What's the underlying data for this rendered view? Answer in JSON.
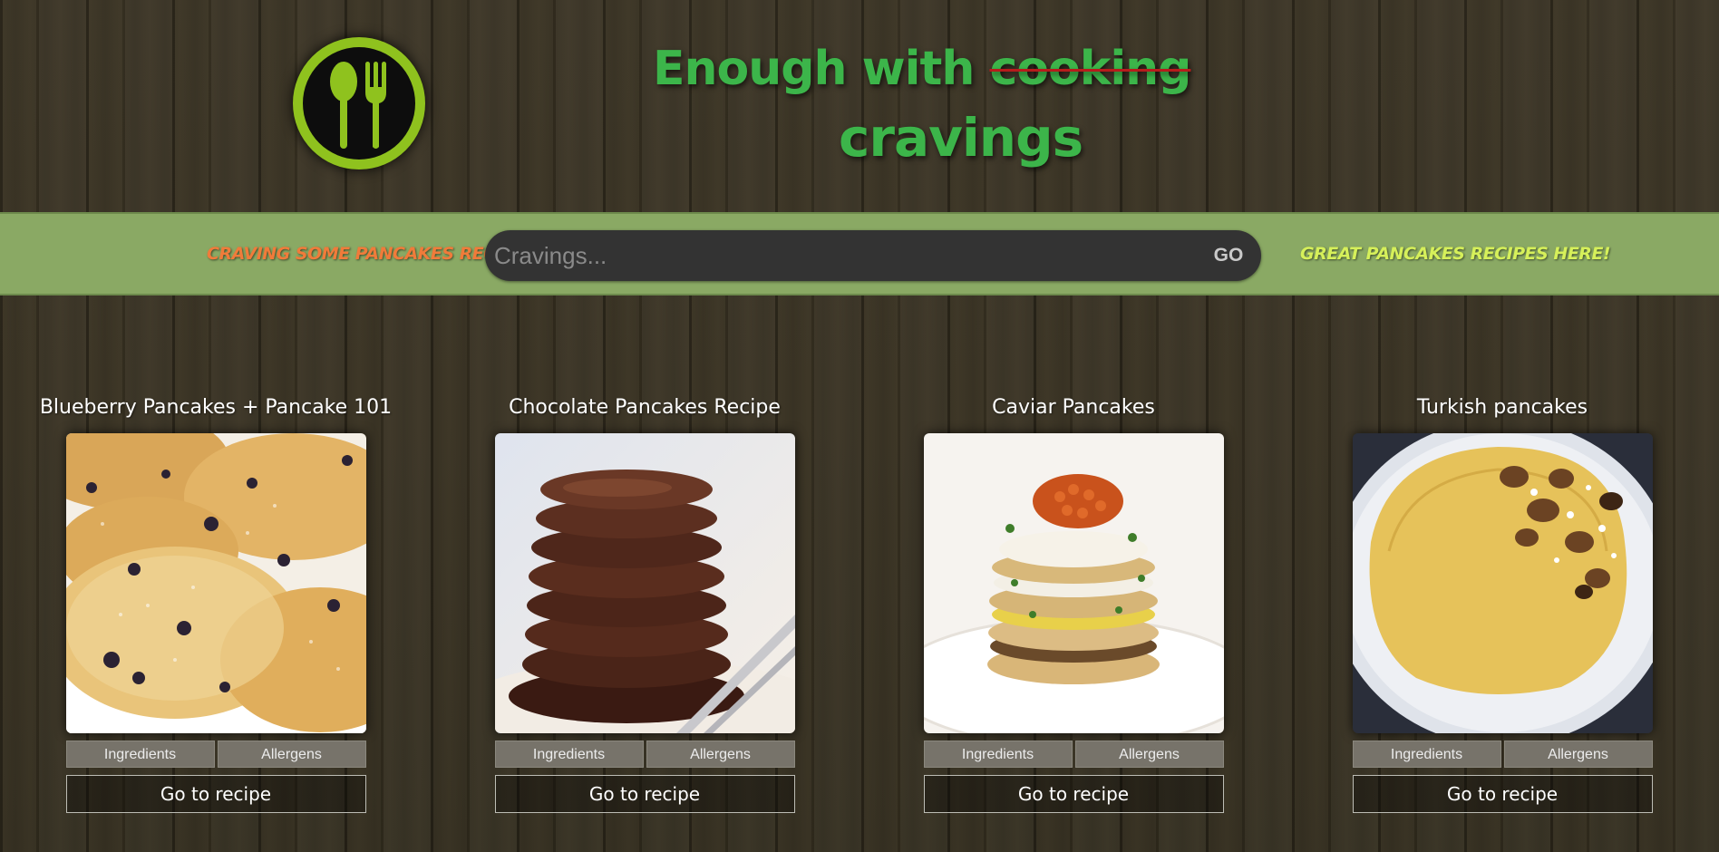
{
  "header": {
    "headline_prefix": "Enough with ",
    "headline_struck": "cooking",
    "headline_second": "cravings"
  },
  "banner": {
    "left_tag": "Craving some pancakes recipes?",
    "right_tag": "Great pancakes recipes here!",
    "search_placeholder": "Cravings...",
    "search_value": "",
    "go_label": "GO"
  },
  "cards": [
    {
      "title": "Blueberry Pancakes + Pancake 101",
      "ingredients_label": "Ingredients",
      "allergens_label": "Allergens",
      "button_label": "Go to recipe"
    },
    {
      "title": "Chocolate Pancakes Recipe",
      "ingredients_label": "Ingredients",
      "allergens_label": "Allergens",
      "button_label": "Go to recipe"
    },
    {
      "title": "Caviar Pancakes",
      "ingredients_label": "Ingredients",
      "allergens_label": "Allergens",
      "button_label": "Go to recipe"
    },
    {
      "title": "Turkish pancakes",
      "ingredients_label": "Ingredients",
      "allergens_label": "Allergens",
      "button_label": "Go to recipe"
    }
  ],
  "colors": {
    "accent_green": "#3cb54a",
    "logo_green": "#8fc21e",
    "banner_green": "#8aa964",
    "left_tag_orange": "#f07b3a",
    "right_tag_yellow": "#d6f05a",
    "strike_red": "#b71c1c"
  },
  "icons": {
    "logo": "spoon-fork-icon"
  }
}
